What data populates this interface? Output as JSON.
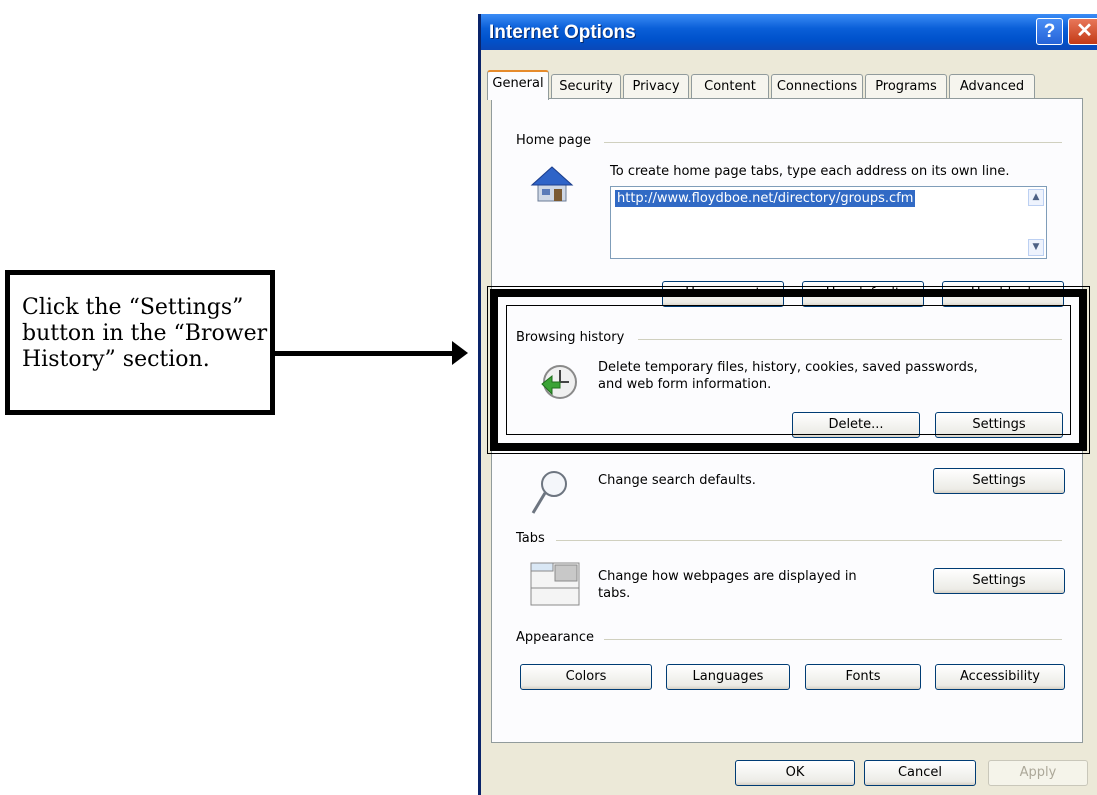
{
  "annotation": {
    "text": "Click the “Settings” button in the “Brower History” section."
  },
  "dialog": {
    "title": "Internet Options",
    "help_label": "?",
    "close_label": "✕",
    "tabs": [
      {
        "label": "General"
      },
      {
        "label": "Security"
      },
      {
        "label": "Privacy"
      },
      {
        "label": "Content"
      },
      {
        "label": "Connections"
      },
      {
        "label": "Programs"
      },
      {
        "label": "Advanced"
      }
    ],
    "home_page": {
      "label": "Home page",
      "description": "To create home page tabs, type each address on its own line.",
      "url": "http://www.floydboe.net/directory/groups.cfm",
      "buttons": [
        "Use current",
        "Use default",
        "Use blank"
      ],
      "icon": "house-icon"
    },
    "browsing_history": {
      "label": "Browsing history",
      "description_line1": "Delete temporary files, history, cookies, saved passwords,",
      "description_line2": "and web form information.",
      "delete_label": "Delete...",
      "settings_label": "Settings",
      "icon": "history-clock-icon"
    },
    "search": {
      "description": "Change search defaults.",
      "settings_label": "Settings",
      "icon": "magnifier-icon"
    },
    "tabs_section": {
      "label": "Tabs",
      "description_line1": "Change how webpages are displayed in",
      "description_line2": "tabs.",
      "settings_label": "Settings",
      "icon": "tabs-window-icon"
    },
    "appearance": {
      "label": "Appearance",
      "buttons": [
        "Colors",
        "Languages",
        "Fonts",
        "Accessibility"
      ]
    },
    "footer": {
      "ok_label": "OK",
      "cancel_label": "Cancel",
      "apply_label": "Apply"
    }
  }
}
